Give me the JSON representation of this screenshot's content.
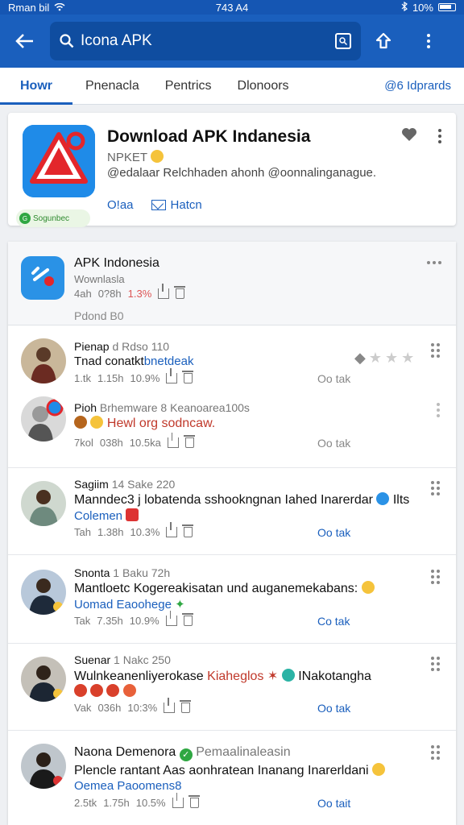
{
  "status_bar": {
    "carrier": "Rman bil",
    "time": "743 A4",
    "battery": "10%"
  },
  "app_bar": {
    "search_query": "Icona APK"
  },
  "tabs": [
    {
      "label": "Howr",
      "active": true
    },
    {
      "label": "Pnenacla"
    },
    {
      "label": "Pentrics"
    },
    {
      "label": "Dlonoors"
    },
    {
      "label": "@6 Idprards"
    }
  ],
  "featured": {
    "title": "Download APK Indanesia",
    "subtitle": "NPKET",
    "description": "@edalaar Relchhaden ahonh @oonnalinganague.",
    "badge": "Sogunbec",
    "link1": "O!aa",
    "link2": "Hatcn"
  },
  "feed_header": {
    "title": "APK Indonesia",
    "subtitle": "Wownlasla",
    "stats": {
      "a": "4ah",
      "b": "0?8h",
      "c": "1.3%"
    },
    "footer": "Pdond B0"
  },
  "posts": [
    {
      "name": "Pienap",
      "meta": "d Rdso 110",
      "text": "Tnad conatkt",
      "text_link": "bnetdeak",
      "stats": [
        "1.tk",
        "1.15h",
        "10.9%"
      ],
      "link": "Oo tak"
    },
    {
      "name": "Pioh",
      "meta": "Brhemware 8 Keanoarea100s",
      "text": "Hewl org sodncaw.",
      "stats": [
        "7kol",
        "038h",
        "10.5ka"
      ],
      "link": "Oo tak"
    },
    {
      "name": "Sagiim",
      "meta": "14 Sake 220",
      "text": "Manndec3 j lobatenda sshookngnan Iahed Inarerdar",
      "text_suffix": "Ilts",
      "text2": "Colemen",
      "stats": [
        "Tah",
        "1.38h",
        "10.3%"
      ],
      "link": "Oo tak"
    },
    {
      "name": "Snonta",
      "meta": "1 Baku 72h",
      "text": "Mantloetc Kogereakisatan und auganemekabans:",
      "text2": "Uomad Eaoohege",
      "stats": [
        "Tak",
        "7.35h",
        "10.9%"
      ],
      "link": "Co tak"
    },
    {
      "name": "Suenar",
      "meta": "1 Nakc 250",
      "text": "Wulnkeanenliyerokase",
      "text_red": "Kiaheglos",
      "text_suffix": "INakotangha",
      "stats": [
        "Vak",
        "036h",
        "10:3%"
      ],
      "link": "Oo tak"
    },
    {
      "name": "Naona Demenora",
      "meta": "Pemaalinaleasin",
      "text": "Plencle rantant Aas aonhratean Inanang Inarerldani",
      "text2": "Oemea Paoomens8",
      "stats": [
        "2.5tk",
        "1.75h",
        "10.5%"
      ],
      "link": "Oo tait"
    }
  ]
}
